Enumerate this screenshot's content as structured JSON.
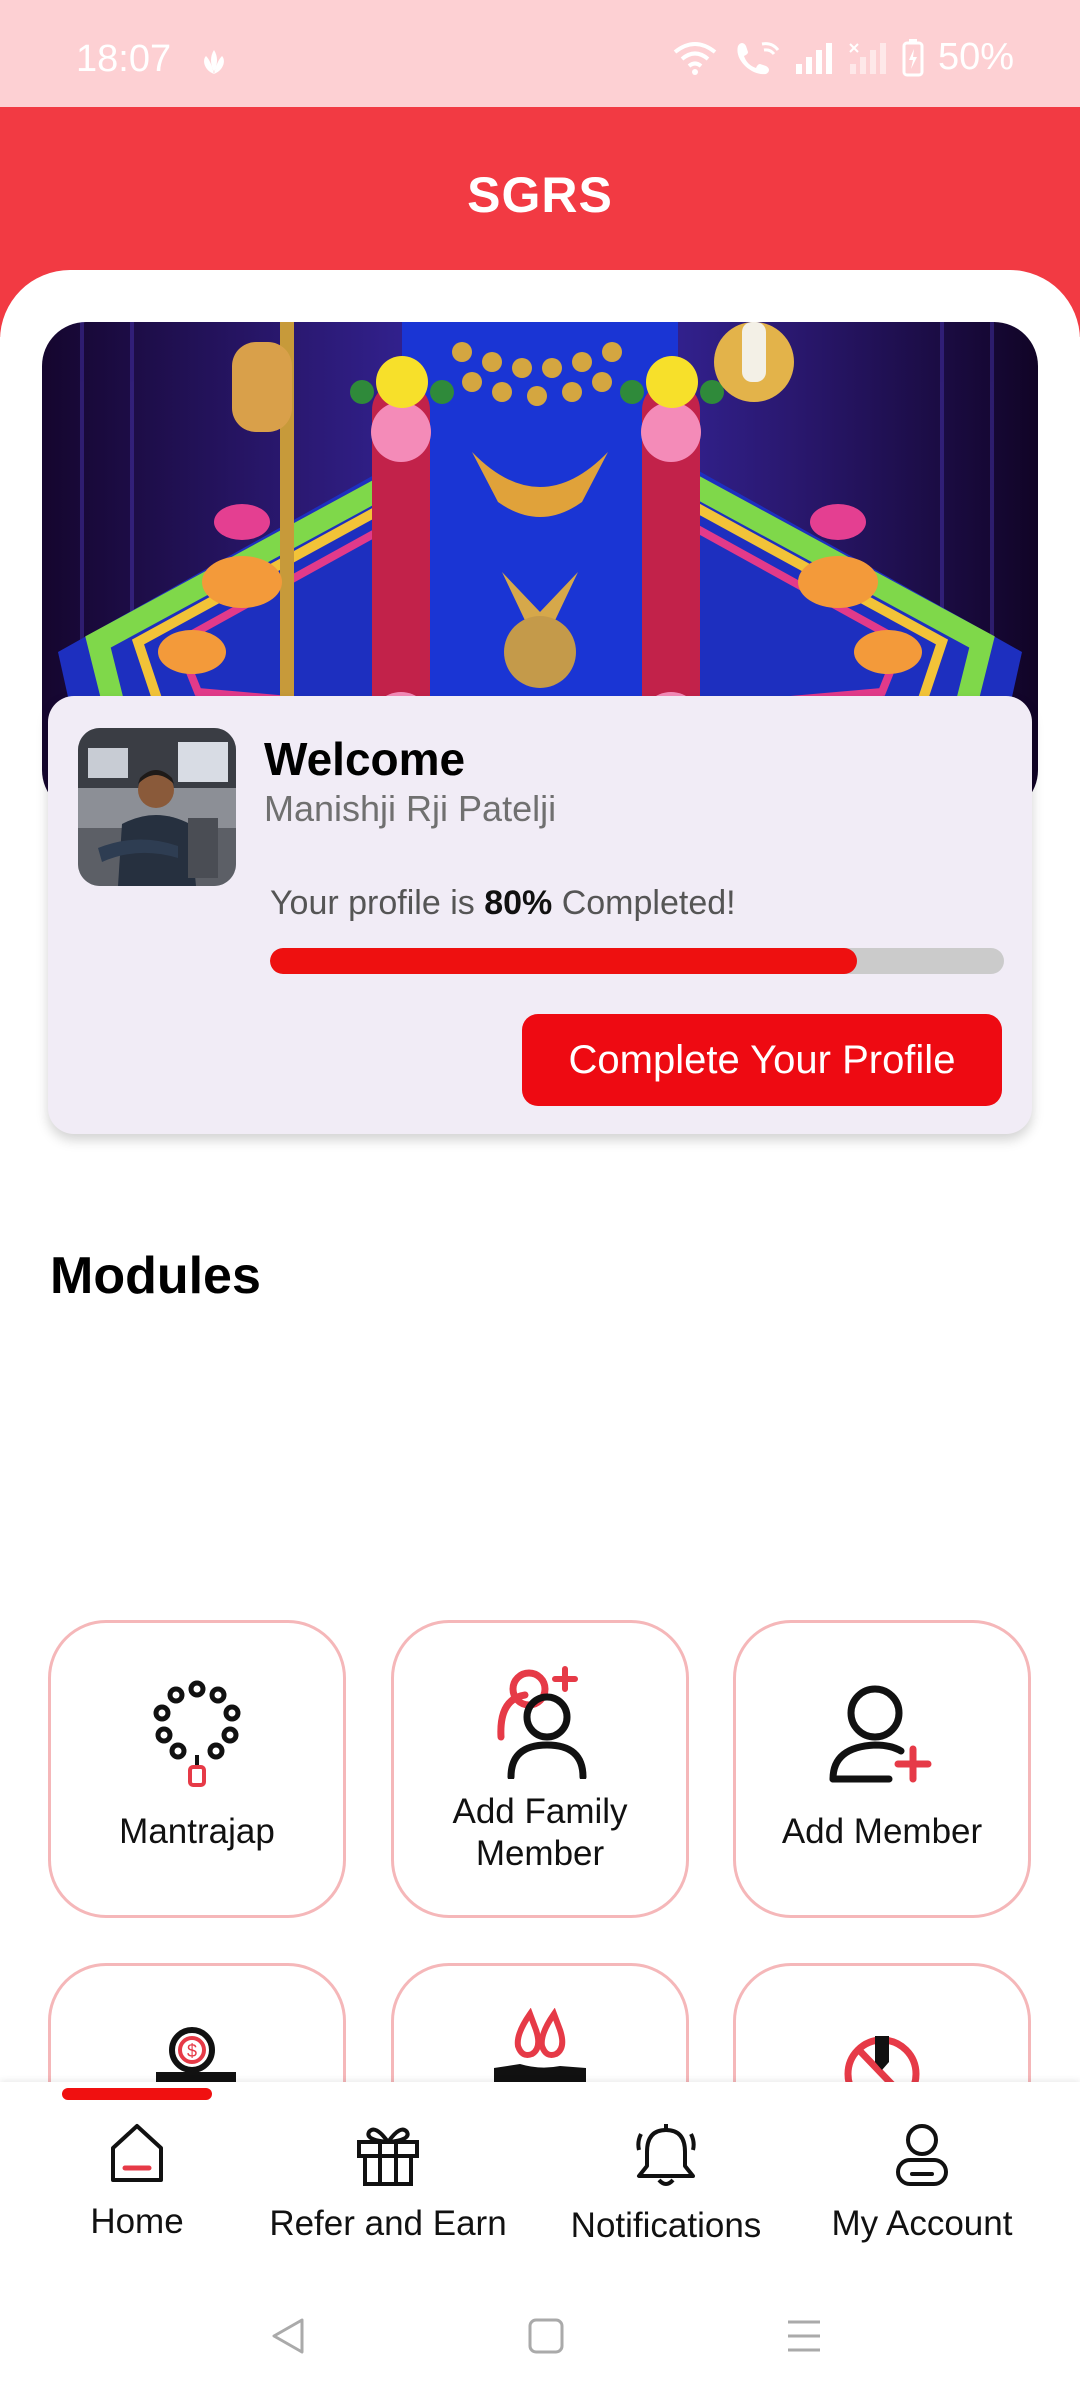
{
  "status_bar": {
    "time": "18:07",
    "battery": "50%",
    "icons": [
      "flower-icon",
      "wifi-icon",
      "wifi-call-icon",
      "signal-icon",
      "signal-2-icon",
      "battery-icon"
    ]
  },
  "header": {
    "title": "SGRS"
  },
  "banner": {
    "slide_count": 5,
    "active_slide": 1
  },
  "profile_card": {
    "welcome": "Welcome",
    "name": "Manishji Rji Patelji",
    "progress_prefix": "Your profile is",
    "progress_value": "80%",
    "progress_suffix": "Completed!",
    "progress_fraction": 0.8,
    "button_label": "Complete Your Profile"
  },
  "modules": {
    "title": "Modules",
    "items": [
      {
        "label": "Mantrajap",
        "icon": "mala-beads-icon"
      },
      {
        "label": "Add Family Member",
        "icon": "add-family-icon"
      },
      {
        "label": "Add Member",
        "icon": "add-member-icon"
      },
      {
        "label": "",
        "icon": "donation-icon"
      },
      {
        "label": "",
        "icon": "drops-hand-icon"
      },
      {
        "label": "",
        "icon": "blocked-icon"
      }
    ]
  },
  "bottom_nav": {
    "items": [
      {
        "label": "Home",
        "icon": "home-icon"
      },
      {
        "label": "Refer and Earn",
        "icon": "gift-icon"
      },
      {
        "label": "Notifications",
        "icon": "bell-icon"
      },
      {
        "label": "My Account",
        "icon": "account-icon"
      }
    ],
    "active": "Home"
  },
  "colors": {
    "primary": "#f23a43",
    "accent": "#ee0a12",
    "card_bg": "#f1ecf6",
    "status_bg": "#fdd0d3"
  }
}
